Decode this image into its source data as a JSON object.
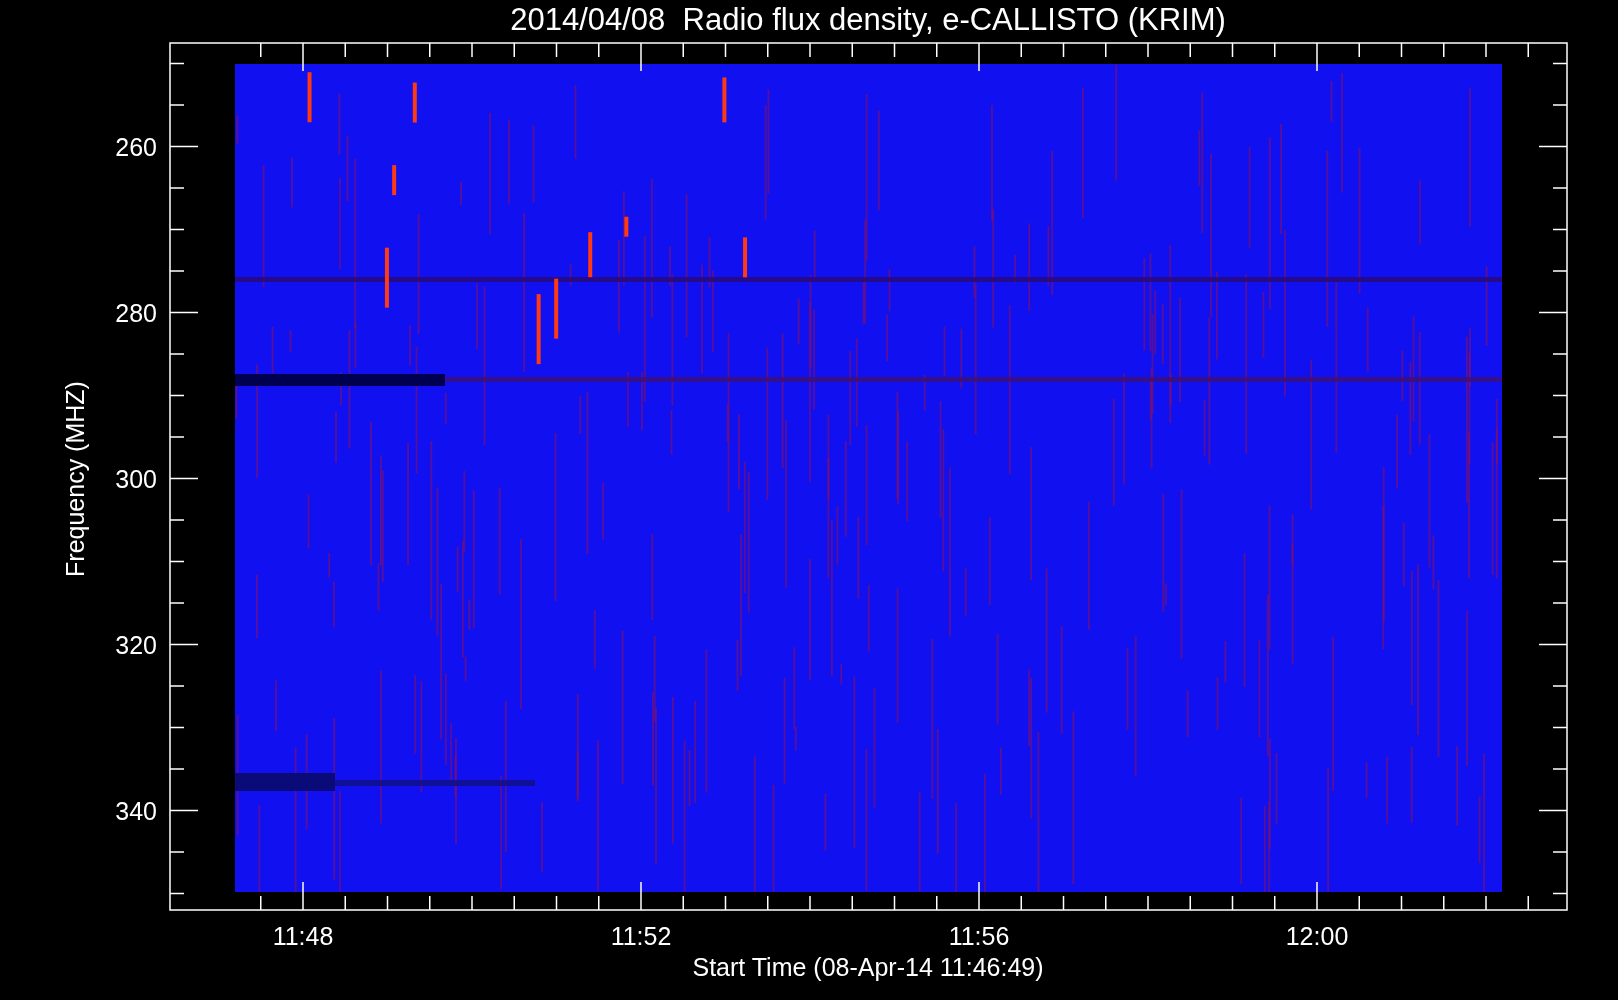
{
  "title": "2014/04/08  Radio flux density, e-CALLISTO (KRIM)",
  "y_axis": {
    "label": "Frequency (MHZ)",
    "ticks": [
      "260",
      "280",
      "300",
      "320",
      "340"
    ]
  },
  "x_axis": {
    "label": "Start Time (08-Apr-14 11:46:49)",
    "ticks": [
      "11:48",
      "11:52",
      "11:56",
      "12:00"
    ]
  }
}
